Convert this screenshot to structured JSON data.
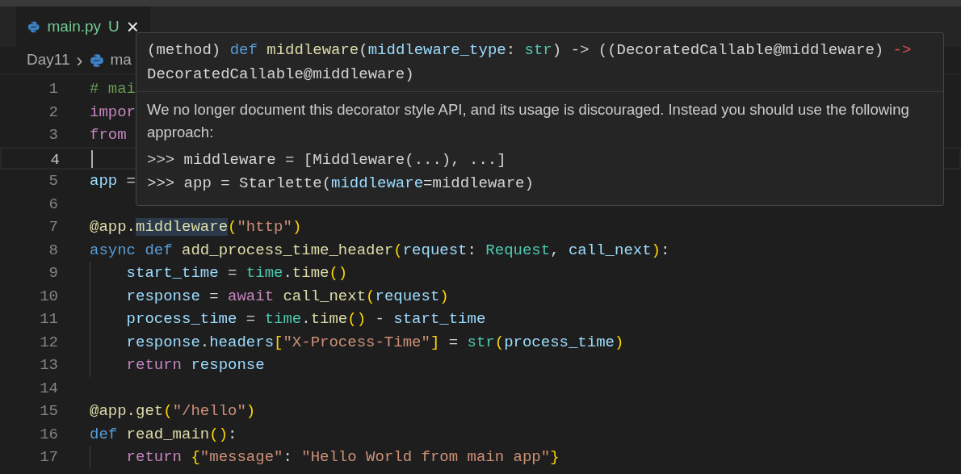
{
  "tab": {
    "file_name": "main.py",
    "status": "U",
    "close": "×",
    "selected": true
  },
  "breadcrumb": {
    "folder": "Day11",
    "separator": "›",
    "file": "ma"
  },
  "editor": {
    "lines": [
      {
        "number": "1",
        "tokens": [
          {
            "kind": "comment",
            "text": "# mai"
          }
        ]
      },
      {
        "number": "2",
        "tokens": [
          {
            "kind": "control",
            "text": "impor"
          }
        ]
      },
      {
        "number": "3",
        "tokens": [
          {
            "kind": "control",
            "text": "from"
          }
        ]
      },
      {
        "number": "4",
        "cursor": true
      },
      {
        "number": "5",
        "tokens": [
          {
            "kind": "variable",
            "text": "app"
          },
          {
            "kind": "plain",
            "text": " ="
          }
        ]
      },
      {
        "number": "6"
      },
      {
        "number": "7",
        "tokens": [
          {
            "kind": "function",
            "text": "@app."
          },
          {
            "kind": "function",
            "text": "middleware",
            "highlighted": true
          },
          {
            "kind": "bracket",
            "text": "("
          },
          {
            "kind": "string",
            "text": "\"http\""
          },
          {
            "kind": "bracket",
            "text": ")"
          }
        ]
      },
      {
        "number": "8",
        "tokens": [
          {
            "kind": "keyword",
            "text": "async def "
          },
          {
            "kind": "function",
            "text": "add_process_time_header"
          },
          {
            "kind": "bracket",
            "text": "("
          },
          {
            "kind": "variable",
            "text": "request"
          },
          {
            "kind": "plain",
            "text": ": "
          },
          {
            "kind": "type",
            "text": "Request"
          },
          {
            "kind": "plain",
            "text": ", "
          },
          {
            "kind": "variable",
            "text": "call_next"
          },
          {
            "kind": "bracket",
            "text": ")"
          },
          {
            "kind": "plain",
            "text": ":"
          }
        ]
      },
      {
        "number": "9",
        "tokens": [
          {
            "kind": "indent"
          },
          {
            "kind": "variable",
            "text": "start_time"
          },
          {
            "kind": "plain",
            "text": " = "
          },
          {
            "kind": "type",
            "text": "time"
          },
          {
            "kind": "plain",
            "text": "."
          },
          {
            "kind": "function",
            "text": "time"
          },
          {
            "kind": "bracket",
            "text": "()"
          }
        ]
      },
      {
        "number": "10",
        "tokens": [
          {
            "kind": "indent"
          },
          {
            "kind": "variable",
            "text": "response"
          },
          {
            "kind": "plain",
            "text": " = "
          },
          {
            "kind": "control",
            "text": "await "
          },
          {
            "kind": "function",
            "text": "call_next"
          },
          {
            "kind": "bracket",
            "text": "("
          },
          {
            "kind": "variable",
            "text": "request"
          },
          {
            "kind": "bracket",
            "text": ")"
          }
        ]
      },
      {
        "number": "11",
        "tokens": [
          {
            "kind": "indent"
          },
          {
            "kind": "variable",
            "text": "process_time"
          },
          {
            "kind": "plain",
            "text": " = "
          },
          {
            "kind": "type",
            "text": "time"
          },
          {
            "kind": "plain",
            "text": "."
          },
          {
            "kind": "function",
            "text": "time"
          },
          {
            "kind": "bracket",
            "text": "()"
          },
          {
            "kind": "plain",
            "text": " - "
          },
          {
            "kind": "variable",
            "text": "start_time"
          }
        ]
      },
      {
        "number": "12",
        "tokens": [
          {
            "kind": "indent"
          },
          {
            "kind": "variable",
            "text": "response"
          },
          {
            "kind": "plain",
            "text": "."
          },
          {
            "kind": "variable",
            "text": "headers"
          },
          {
            "kind": "bracket",
            "text": "["
          },
          {
            "kind": "string",
            "text": "\"X-Process-Time\""
          },
          {
            "kind": "bracket",
            "text": "]"
          },
          {
            "kind": "plain",
            "text": " = "
          },
          {
            "kind": "type",
            "text": "str"
          },
          {
            "kind": "bracket",
            "text": "("
          },
          {
            "kind": "variable",
            "text": "process_time"
          },
          {
            "kind": "bracket",
            "text": ")"
          }
        ]
      },
      {
        "number": "13",
        "tokens": [
          {
            "kind": "indent"
          },
          {
            "kind": "control",
            "text": "return "
          },
          {
            "kind": "variable",
            "text": "response"
          }
        ]
      },
      {
        "number": "14"
      },
      {
        "number": "15",
        "tokens": [
          {
            "kind": "function",
            "text": "@app.get"
          },
          {
            "kind": "bracket",
            "text": "("
          },
          {
            "kind": "string",
            "text": "\"/hello\""
          },
          {
            "kind": "bracket",
            "text": ")"
          }
        ]
      },
      {
        "number": "16",
        "tokens": [
          {
            "kind": "keyword",
            "text": "def "
          },
          {
            "kind": "function",
            "text": "read_main"
          },
          {
            "kind": "bracket",
            "text": "()"
          },
          {
            "kind": "plain",
            "text": ":"
          }
        ]
      },
      {
        "number": "17",
        "tokens": [
          {
            "kind": "indent"
          },
          {
            "kind": "control",
            "text": "return "
          },
          {
            "kind": "bracket",
            "text": "{"
          },
          {
            "kind": "string",
            "text": "\"message\""
          },
          {
            "kind": "plain",
            "text": ": "
          },
          {
            "kind": "string",
            "text": "\"Hello World from main app\""
          },
          {
            "kind": "bracket",
            "text": "}"
          }
        ]
      }
    ]
  },
  "hover": {
    "signature": [
      [
        {
          "kind": "plain",
          "text": "(method) "
        },
        {
          "kind": "keyword",
          "text": "def "
        },
        {
          "kind": "function",
          "text": "middleware"
        },
        {
          "kind": "plain",
          "text": "("
        },
        {
          "kind": "variable",
          "text": "middleware_type"
        },
        {
          "kind": "plain",
          "text": ": "
        },
        {
          "kind": "type",
          "text": "str"
        },
        {
          "kind": "plain",
          "text": ") -> ((DecoratedCallable@middleware) "
        },
        {
          "kind": "arrow",
          "text": "->"
        }
      ],
      [
        {
          "kind": "plain",
          "text": "DecoratedCallable@middleware)"
        }
      ]
    ],
    "description": "We no longer document this decorator style API, and its usage is discouraged. Instead you should use the following approach:",
    "examples": [
      [
        {
          "kind": "plain",
          "text": ">>> middleware = [Middleware(...), ...]"
        }
      ],
      [
        {
          "kind": "plain",
          "text": ">>> app = Starlette("
        },
        {
          "kind": "variable",
          "text": "middleware"
        },
        {
          "kind": "plain",
          "text": "=middleware)"
        }
      ]
    ]
  }
}
